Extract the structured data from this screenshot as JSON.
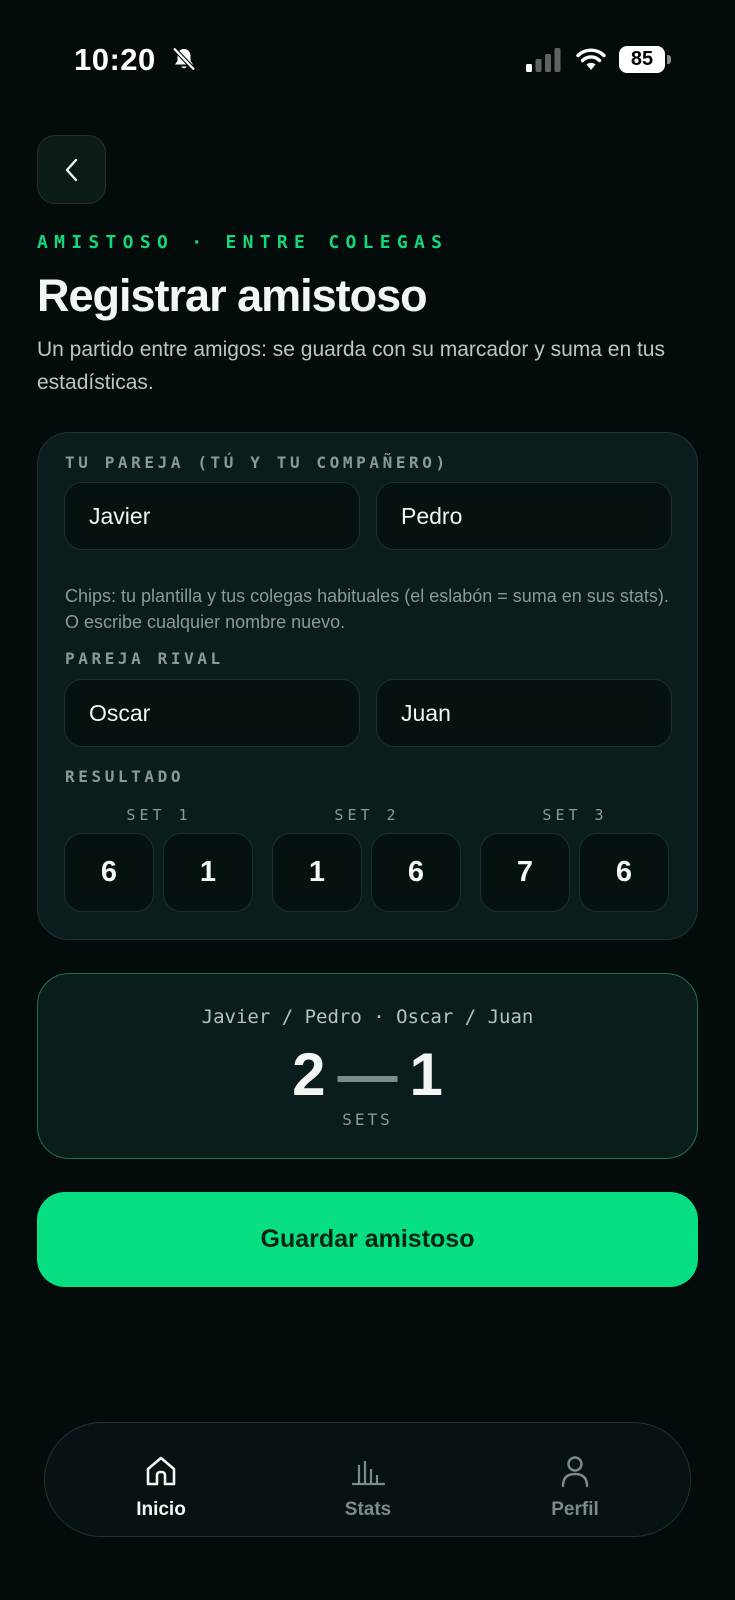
{
  "status_bar": {
    "time": "10:20",
    "battery": "85"
  },
  "header": {
    "eyebrow": "AMISTOSO · ENTRE COLEGAS",
    "title": "Registrar amistoso",
    "subtitle": "Un partido entre amigos: se guarda con su marcador y suma en tus estadísticas."
  },
  "form": {
    "your_pair_label": "TU PAREJA (TÚ Y TU COMPAÑERO)",
    "your_pair": [
      "Javier",
      "Pedro"
    ],
    "hint": "Chips: tu plantilla y tus colegas habituales (el eslabón = suma en sus stats). O escribe cualquier nombre nuevo.",
    "rival_pair_label": "PAREJA RIVAL",
    "rival_pair": [
      "Oscar",
      "Juan"
    ],
    "result_label": "RESULTADO",
    "sets": [
      {
        "label": "SET 1",
        "us": "6",
        "them": "1"
      },
      {
        "label": "SET 2",
        "us": "1",
        "them": "6"
      },
      {
        "label": "SET 3",
        "us": "7",
        "them": "6"
      }
    ]
  },
  "summary": {
    "names": "Javier / Pedro · Oscar / Juan",
    "score_us": "2",
    "score_dash": "—",
    "score_them": "1",
    "unit": "SETS"
  },
  "save_button": "Guardar amistoso",
  "nav": [
    {
      "label": "Inicio",
      "icon": "home-icon",
      "active": true
    },
    {
      "label": "Stats",
      "icon": "stats-icon",
      "active": false
    },
    {
      "label": "Perfil",
      "icon": "profile-icon",
      "active": false
    }
  ],
  "colors": {
    "accent": "#08df82",
    "background": "#040c0b",
    "card": "#0b1c1d"
  }
}
